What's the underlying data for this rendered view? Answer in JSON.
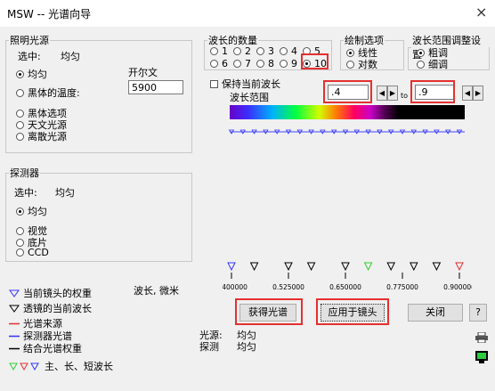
{
  "window": {
    "title": "MSW -- 光谱向导",
    "close": "×"
  },
  "illumination": {
    "legend": "照明光源",
    "selected_label": "选中:",
    "selected_value": "均匀",
    "options": [
      "均匀",
      "黑体的温度:",
      "黑体选项",
      "天文光源",
      "离散光源"
    ],
    "kelvin_label": "开尔文",
    "kelvin_value": "5900"
  },
  "detector": {
    "legend": "探测器",
    "selected_label": "选中:",
    "selected_value": "均匀",
    "options": [
      "均匀",
      "视觉",
      "底片",
      "CCD"
    ]
  },
  "wavelength_count": {
    "legend": "波长的数量",
    "options": [
      "1",
      "2",
      "3",
      "4",
      "5",
      "6",
      "7",
      "8",
      "9",
      "10"
    ],
    "selected": "10"
  },
  "plot_options": {
    "legend": "绘制选项",
    "options": [
      "线性",
      "对数"
    ],
    "selected": "线性"
  },
  "range_adjust": {
    "legend": "波长范围调整设置",
    "options": [
      "粗调",
      "细调"
    ],
    "selected": "粗调"
  },
  "keep_current": {
    "label": "保持当前波长"
  },
  "range": {
    "label": "波长范围",
    "from": ".4",
    "to_label": "to",
    "to": ".9"
  },
  "chart_data": {
    "type": "scatter",
    "xlabel": "波长, 微米",
    "xlim": [
      0.4,
      0.9
    ],
    "ticks": [
      "0.400000",
      "0.525000",
      "0.650000",
      "0.775000",
      "0.900000"
    ],
    "tick_values": [
      0.4,
      0.525,
      0.65,
      0.775,
      0.9
    ],
    "lens_weights": [
      0.4,
      0.425,
      0.45,
      0.475,
      0.5,
      0.525,
      0.55,
      0.575,
      0.6,
      0.625,
      0.65,
      0.675,
      0.7,
      0.725,
      0.75,
      0.775,
      0.8,
      0.825,
      0.85,
      0.875,
      0.9
    ],
    "wavelengths": [
      0.4,
      0.45,
      0.525,
      0.575,
      0.65,
      0.7,
      0.75,
      0.8,
      0.85,
      0.9
    ],
    "primary": 0.7,
    "short": 0.4,
    "long": 0.9
  },
  "legend_items": [
    "当前镜头的权重",
    "透镜的当前波长",
    "光谱来源",
    "探测器光谱",
    "结合光谱权重",
    "主、长、短波长"
  ],
  "colors": {
    "red": "#e53030",
    "green": "#33cc33",
    "blue": "#3333ff",
    "dark": "#000000"
  },
  "buttons": {
    "get_spectrum": "获得光谱",
    "apply": "应用于镜头",
    "close": "关闭",
    "help": "?"
  },
  "status": {
    "source_label": "光源:",
    "source_value": "均匀",
    "detector_label": "探测",
    "detector_value": "均匀"
  },
  "icons": {
    "print": "printer-icon",
    "screen": "monitor-icon"
  }
}
